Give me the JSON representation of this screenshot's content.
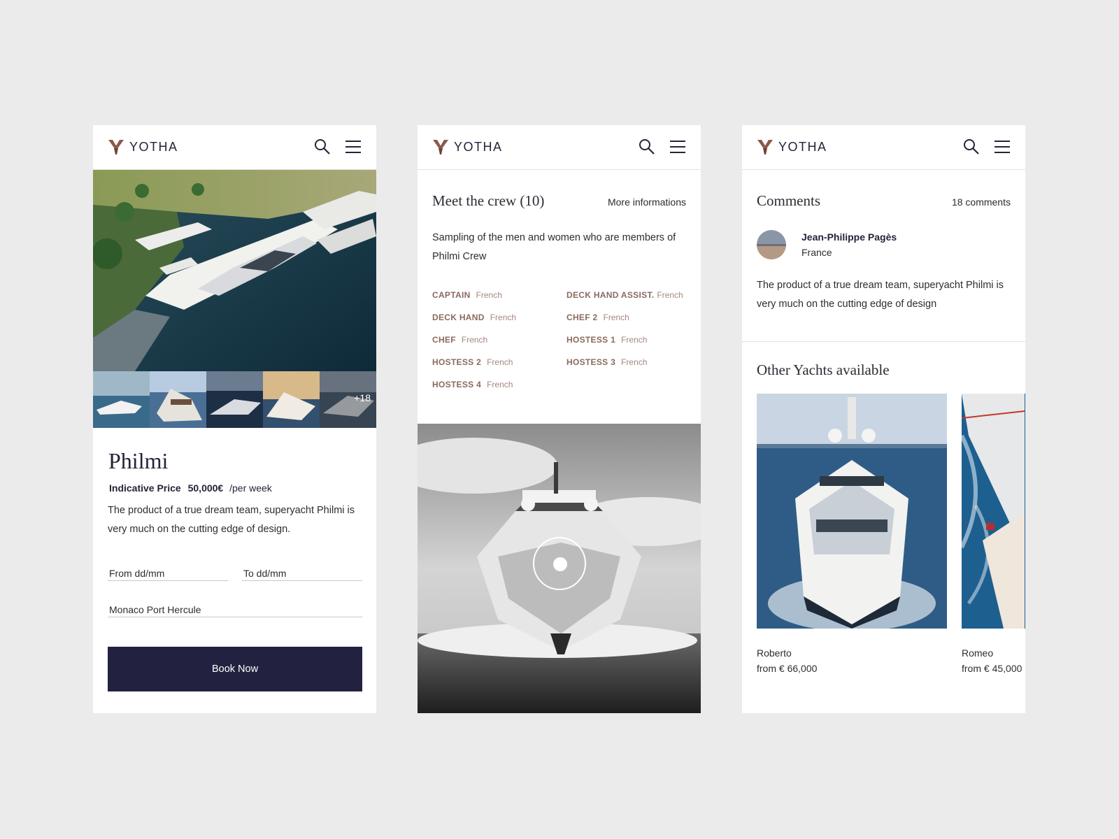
{
  "brand": {
    "name": "YOTHA",
    "accent": "#8b5a4a",
    "navy": "#222240"
  },
  "icons": {
    "search": "search-icon",
    "menu": "hamburger-menu-icon",
    "logo": "yotha-logo-icon",
    "play": "play-icon"
  },
  "yacht": {
    "name": "Philmi",
    "price_label": "Indicative Price",
    "price_amount": "50,000€",
    "price_period": "/per week",
    "description": "The product of a true dream team, superyacht Philmi is very much on the cutting edge of design.",
    "more_photos": "+18"
  },
  "booking": {
    "from_placeholder": "From dd/mm",
    "to_placeholder": "To dd/mm",
    "port_value": "Monaco Port Hercule",
    "button_label": "Book Now"
  },
  "crew": {
    "title": "Meet the crew (10)",
    "link": "More informations",
    "intro": "Sampling of the men and women who are members of Philmi Crew",
    "members": [
      {
        "role": "CAPTAIN",
        "nationality": "French"
      },
      {
        "role": "DECK HAND ASSIST.",
        "nationality": "French"
      },
      {
        "role": "DECK HAND",
        "nationality": "French"
      },
      {
        "role": "CHEF 2",
        "nationality": "French"
      },
      {
        "role": "CHEF",
        "nationality": "French"
      },
      {
        "role": "HOSTESS 1",
        "nationality": "French"
      },
      {
        "role": "HOSTESS 2",
        "nationality": "French"
      },
      {
        "role": "HOSTESS 3",
        "nationality": "French"
      },
      {
        "role": "HOSTESS 4",
        "nationality": "French"
      }
    ]
  },
  "comments": {
    "title": "Comments",
    "count": "18 comments",
    "items": [
      {
        "author": "Jean-Philippe Pagès",
        "country": "France",
        "text": "The product of a true dream team, superyacht Philmi is very much on the cutting edge of design"
      }
    ]
  },
  "other_yachts": {
    "title": "Other Yachts available",
    "items": [
      {
        "name": "Roberto",
        "price": "from € 66,000"
      },
      {
        "name": "Romeo",
        "price": "from € 45,000"
      }
    ]
  }
}
